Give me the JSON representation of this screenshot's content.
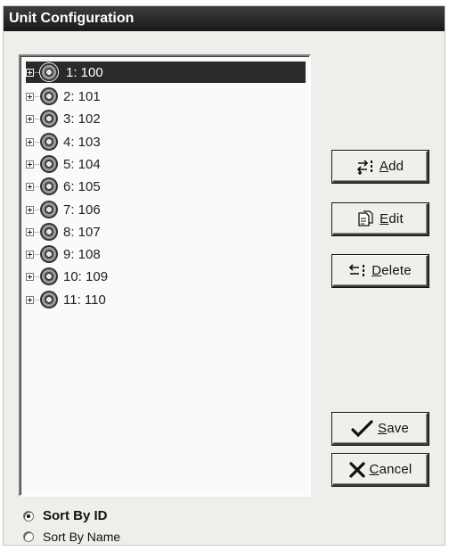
{
  "window": {
    "title": "Unit Configuration"
  },
  "tree": {
    "items": [
      {
        "label": "1: 100",
        "selected": true
      },
      {
        "label": "2: 101"
      },
      {
        "label": "3: 102"
      },
      {
        "label": "4: 103"
      },
      {
        "label": "5: 104"
      },
      {
        "label": "6: 105"
      },
      {
        "label": "7: 106"
      },
      {
        "label": "8: 107"
      },
      {
        "label": "9: 108"
      },
      {
        "label": "10: 109"
      },
      {
        "label": "11: 110"
      }
    ]
  },
  "buttons": {
    "add": {
      "accel": "A",
      "rest": "dd"
    },
    "edit": {
      "accel": "E",
      "rest": "dit"
    },
    "delete": {
      "accel": "D",
      "rest": "elete"
    },
    "save": {
      "accel": "S",
      "rest": "ave"
    },
    "cancel": {
      "accel": "C",
      "rest": "ancel"
    }
  },
  "sort": {
    "by_id": "Sort By ID",
    "by_name": "Sort By Name",
    "selected": "by_id"
  },
  "icons": {
    "unit": "unit-disc-icon",
    "add": "add-arrows-icon",
    "edit": "edit-document-icon",
    "delete": "delete-arrows-icon",
    "save": "checkmark-icon",
    "cancel": "x-mark-icon"
  },
  "colors": {
    "selection": "#2a2a2a",
    "title_bar": "#181818",
    "dialog_bg": "#eeeeea"
  }
}
